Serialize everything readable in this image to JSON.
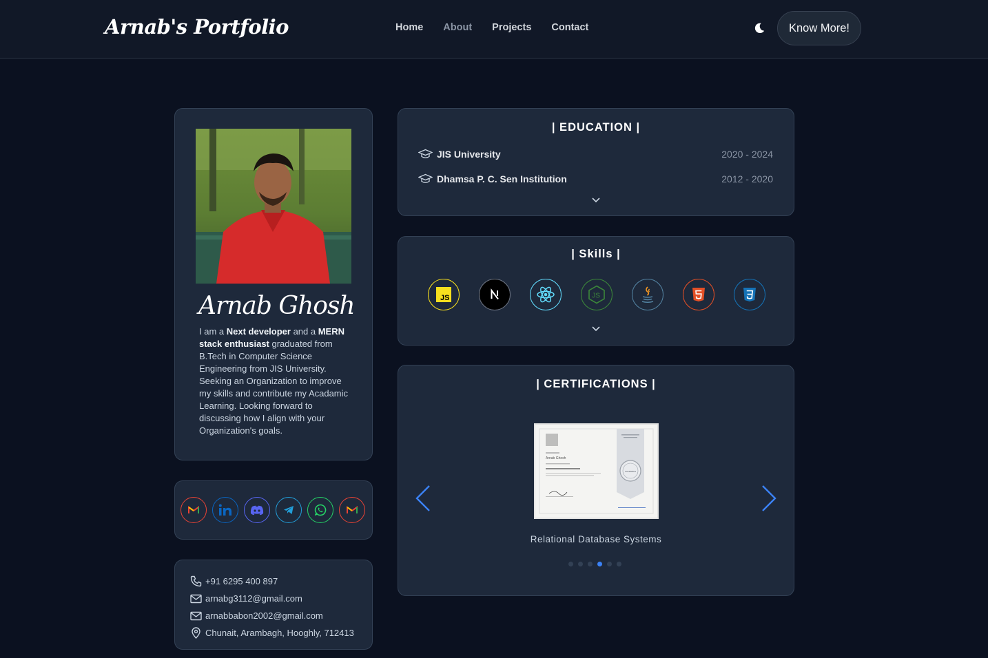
{
  "header": {
    "logo": "Arnab's Portfolio",
    "nav": [
      "Home",
      "About",
      "Projects",
      "Contact"
    ],
    "theme_icon": "moon-icon",
    "cta_label": "Know More!"
  },
  "profile": {
    "name": "Arnab Ghosh",
    "bio": {
      "p1": "I am a ",
      "b1": "Next developer",
      "p2": " and a ",
      "b2": "MERN stack enthusiast",
      "p3": " graduated from B.Tech in Computer Science Engineering from JIS University. Seeking an Organization to improve my skills and contribute my Acadamic Learning. Looking forward to discussing how I align with your Organization's goals."
    }
  },
  "socials": [
    {
      "name": "gmail-icon",
      "color": "#ea4335"
    },
    {
      "name": "linkedin-icon",
      "color": "#0a66c2"
    },
    {
      "name": "discord-icon",
      "color": "#5865f2"
    },
    {
      "name": "telegram-icon",
      "color": "#229ed9"
    },
    {
      "name": "whatsapp-icon",
      "color": "#25d366"
    },
    {
      "name": "gmail-icon",
      "color": "#ea4335"
    }
  ],
  "contact": {
    "phone": "+91 6295 400 897",
    "email1": "arnabg3112@gmail.com",
    "email2": "arnabbabon2002@gmail.com",
    "address": "Chunait, Arambagh, Hooghly, 712413"
  },
  "education": {
    "title": "| EDUCATION |",
    "items": [
      {
        "school": "JIS University",
        "years": "2020 - 2024"
      },
      {
        "school": "Dhamsa P. C. Sen Institution",
        "years": "2012 - 2020"
      }
    ]
  },
  "skills": {
    "title": "| Skills |",
    "icons": [
      {
        "name": "javascript-icon",
        "color": "#f7df1e"
      },
      {
        "name": "nextjs-icon",
        "color": "#ffffff"
      },
      {
        "name": "react-icon",
        "color": "#61dafb"
      },
      {
        "name": "nodejs-icon",
        "color": "#3c873a"
      },
      {
        "name": "java-icon",
        "color": "#5382a1"
      },
      {
        "name": "html5-icon",
        "color": "#e34f26"
      },
      {
        "name": "css3-icon",
        "color": "#1572b6"
      }
    ]
  },
  "certifications": {
    "title": "| CERTIFICATIONS |",
    "caption": "Relational Database Systems",
    "cert_issuer_badge": "coursera",
    "cert_holder": "Arnab Ghosh",
    "dot_count": 6,
    "active_dot": 3,
    "accent": "#3b82f6"
  }
}
